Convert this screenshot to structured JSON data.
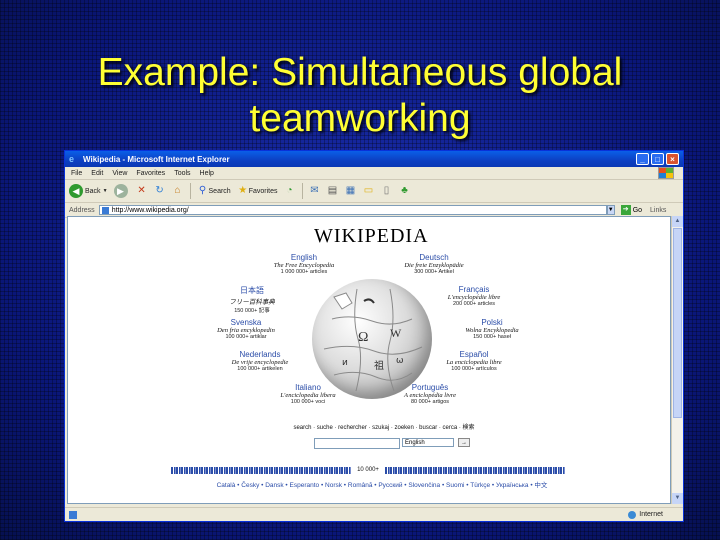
{
  "slide": {
    "title_line1": "Example: Simultaneous global",
    "title_line2": "teamworking"
  },
  "window": {
    "title": "Wikipedia - Microsoft Internet Explorer",
    "buttons": {
      "minimize": "_",
      "maximize": "□",
      "close": "×"
    }
  },
  "menu": [
    "File",
    "Edit",
    "View",
    "Favorites",
    "Tools",
    "Help"
  ],
  "toolbar": {
    "back": "Back",
    "search": "Search",
    "favorites": "Favorites"
  },
  "address": {
    "label": "Address",
    "url": "http://www.wikipedia.org/",
    "go": "Go",
    "links": "Links"
  },
  "page": {
    "logo": "WIKIPEDIA",
    "languages": [
      {
        "name": "English",
        "tagline": "The Free Encyclopedia",
        "count": "1 000 000+ articles"
      },
      {
        "name": "Deutsch",
        "tagline": "Die freie Enzyklopädie",
        "count": "300 000+ Artikel"
      },
      {
        "name": "日本語",
        "tagline": "フリー百科事典",
        "count": "150 000+ 記事"
      },
      {
        "name": "Français",
        "tagline": "L'encyclopédie libre",
        "count": "200 000+ articles"
      },
      {
        "name": "Svenska",
        "tagline": "Den fria encyklopedin",
        "count": "100 000+ artiklar"
      },
      {
        "name": "Polski",
        "tagline": "Wolna Encyklopedia",
        "count": "150 000+ haseł"
      },
      {
        "name": "Nederlands",
        "tagline": "De vrije encyclopedie",
        "count": "100 000+ artikelen"
      },
      {
        "name": "Español",
        "tagline": "La enciclopedia libre",
        "count": "100 000+ artículos"
      },
      {
        "name": "Italiano",
        "tagline": "L'enciclopedia libera",
        "count": "100 000+ voci"
      },
      {
        "name": "Português",
        "tagline": "A enciclopédia livre",
        "count": "80 000+ artigos"
      }
    ],
    "search_prompt": "search · suche · rechercher · szukaj · zoeken · buscar · cerca · 検索",
    "search_select": "English",
    "search_button": "→",
    "more_count": "10 000+",
    "lang_strip": "Català • Česky • Dansk • Esperanto • Norsk • Română • Русский • Slovenčina • Suomi • Türkçe • Українська • 中文"
  },
  "status": {
    "zone": "Internet"
  },
  "colors": {
    "slide_bg": "#0b1a8c",
    "title": "#ffff33",
    "xp_blue": "#0a5fe8",
    "link_blue": "#2b4da8"
  }
}
